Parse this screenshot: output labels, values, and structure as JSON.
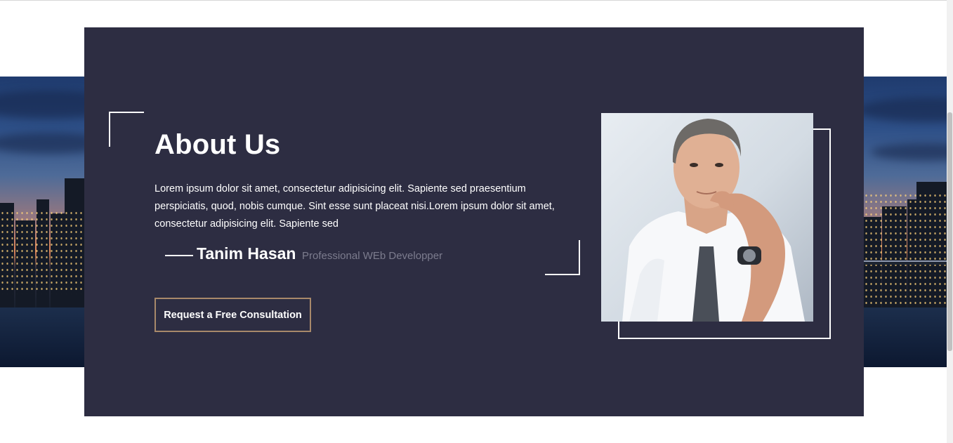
{
  "about": {
    "title": "About Us",
    "body": "Lorem ipsum dolor sit amet, consectetur adipisicing elit. Sapiente sed praesentium perspiciatis, quod, nobis cumque. Sint esse sunt placeat nisi.Lorem ipsum dolor sit amet, consectetur adipisicing elit. Sapiente sed",
    "signature": {
      "name": "Tanim Hasan",
      "role": "Professional WEb Developper"
    },
    "cta_label": "Request a Free Consultation"
  },
  "colors": {
    "panel": "#2d2d42",
    "cta_border": "#a8896a",
    "role_text": "#7c7c8e"
  },
  "images": {
    "background": "city-skyline-dusk-photo",
    "portrait": "man-portrait-photo"
  }
}
